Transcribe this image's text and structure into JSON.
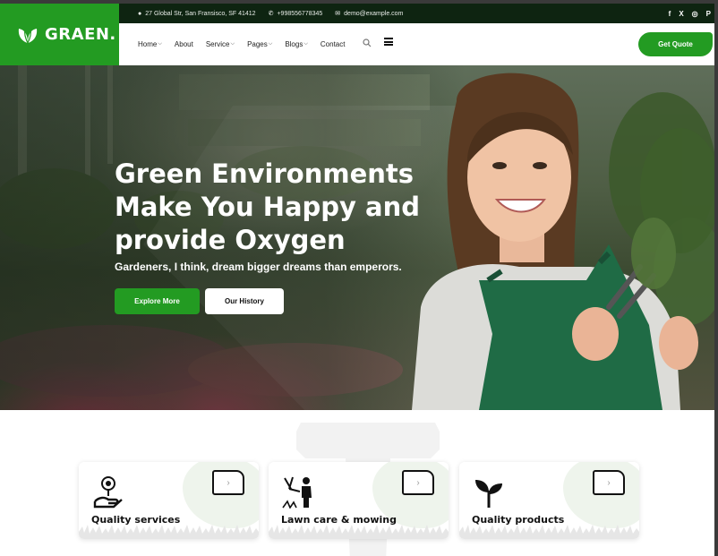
{
  "brand": {
    "name": "GRAEN.",
    "logo_icon": "leaf-icon",
    "accent": "#239b22",
    "topbar_bg": "#0e2411"
  },
  "topbar": {
    "address": "27 Global Str, San Fransisco, SF 41412",
    "phone": "+998556778345",
    "email": "demo@example.com",
    "social": [
      "f",
      "X",
      "ig",
      "P"
    ]
  },
  "nav": {
    "items": [
      "Home",
      "About",
      "Service",
      "Pages",
      "Blogs",
      "Contact"
    ],
    "cta": "Get Quote"
  },
  "hero": {
    "title": "Green Environments Make You Happy and provide Oxygen",
    "subtitle": "Gardeners, I think, dream bigger dreams than emperors.",
    "primary_button": "Explore More",
    "secondary_button": "Our History"
  },
  "services": [
    {
      "title": "Quality services",
      "icon": "hand-flower-icon"
    },
    {
      "title": "Lawn care & mowing",
      "icon": "gardener-icon"
    },
    {
      "title": "Quality products",
      "icon": "sprout-icon"
    }
  ]
}
